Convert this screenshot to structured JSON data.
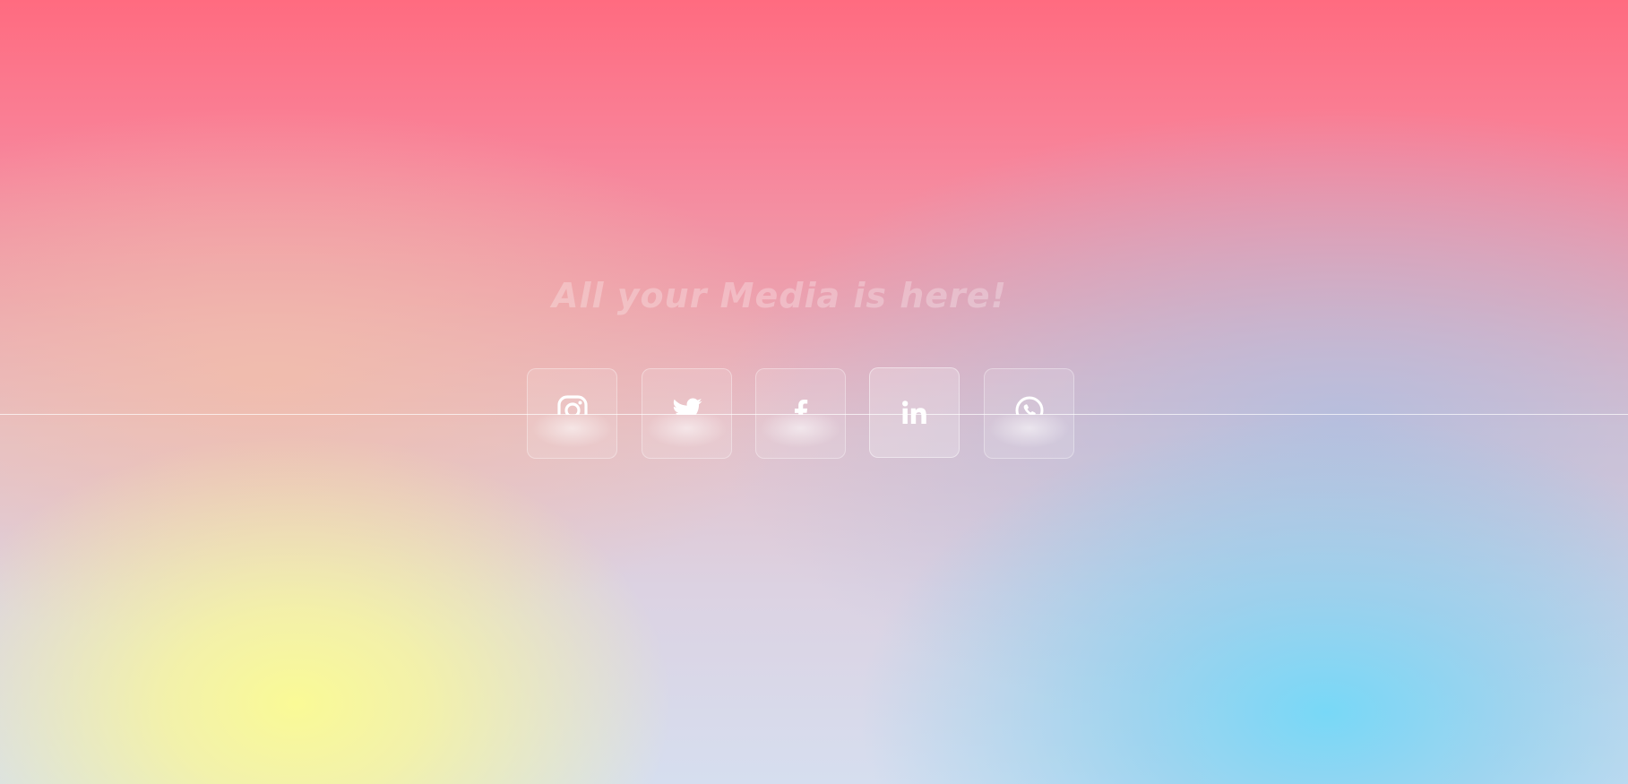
{
  "heading": "All your Media is here!",
  "colors": {
    "top": "#ff6b80",
    "yellow_glow": "#f8f89a",
    "blue_glow": "#78d8f7",
    "icon": "#ffffff"
  },
  "social_icons": [
    {
      "name": "instagram",
      "icon": "instagram-icon",
      "active": false
    },
    {
      "name": "twitter",
      "icon": "twitter-icon",
      "active": false
    },
    {
      "name": "facebook",
      "icon": "facebook-icon",
      "active": false
    },
    {
      "name": "linkedin",
      "icon": "linkedin-icon",
      "active": true
    },
    {
      "name": "whatsapp",
      "icon": "whatsapp-icon",
      "active": false
    }
  ]
}
